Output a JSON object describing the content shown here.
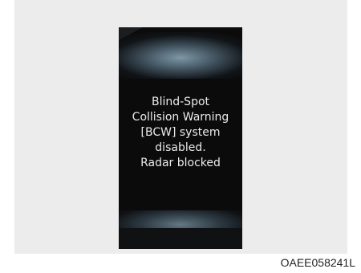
{
  "display": {
    "message_lines": [
      "Blind-Spot",
      "Collision Warning",
      "[BCW] system",
      "disabled.",
      "Radar blocked"
    ]
  },
  "figure": {
    "code": "OAEE058241L"
  },
  "colors": {
    "screen_background": "#0b0b0c",
    "screen_glow": "#849eae",
    "text": "#e9ebec",
    "panel_background": "#ececec"
  }
}
